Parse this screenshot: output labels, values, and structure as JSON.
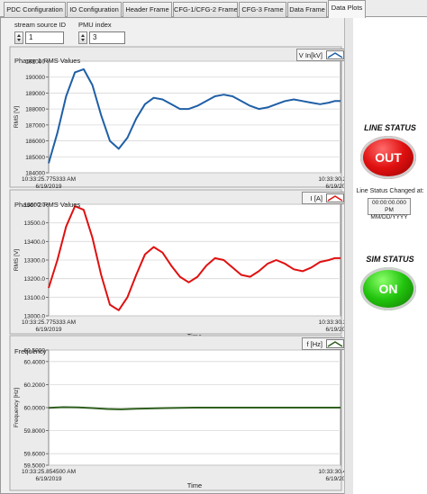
{
  "tabs": [
    {
      "label": "PDC Configuration"
    },
    {
      "label": "IO Configuration"
    },
    {
      "label": "Header Frame"
    },
    {
      "label": "CFG-1/CFG-2 Frame"
    },
    {
      "label": "CFG-3 Frame"
    },
    {
      "label": "Data Frame"
    },
    {
      "label": "Data Plots"
    }
  ],
  "controls": {
    "stream_source": {
      "label": "stream source ID",
      "value": "1"
    },
    "pmu_index": {
      "label": "PMU index",
      "value": "3"
    }
  },
  "charts": [
    {
      "title": "Phasor 1 RMS Values",
      "legend": "V In[kV]",
      "color": "#1f5fa6",
      "ylabel": "RMS [V]",
      "xlabel": "Time",
      "x_start": [
        "10:33:25.775333 AM",
        "6/19/2019"
      ],
      "x_end": [
        "10:33:30.23366",
        "6/19/2019"
      ],
      "yticks": [
        "191000",
        "190000",
        "189000",
        "188000",
        "187000",
        "186000",
        "185000",
        "184000"
      ]
    },
    {
      "title": "Phasor 2 RMS Values",
      "legend": "I [A]",
      "color": "#e01010",
      "ylabel": "RMS [V]",
      "xlabel": "Time",
      "x_start": [
        "10:33:25.775333 AM",
        "6/19/2019"
      ],
      "x_end": [
        "10:33:30.32116",
        "6/19/2019"
      ],
      "yticks": [
        "13600.0",
        "13500.0",
        "13400.0",
        "13300.0",
        "13200.0",
        "13100.0",
        "13000.0"
      ]
    },
    {
      "title": "Frequency",
      "legend": "f [Hz]",
      "color": "#2f5f1e",
      "ylabel": "Frequency [Hz]",
      "xlabel": "Time",
      "x_start": [
        "10:33:25.854500 AM",
        "6/19/2019"
      ],
      "x_end": [
        "10:33:30.40033",
        "6/19/2019"
      ],
      "yticks": [
        "60.5000",
        "60.4000",
        "60.2000",
        "60.0000",
        "59.8000",
        "59.6000",
        "59.5000"
      ]
    }
  ],
  "chart_data": [
    {
      "type": "line",
      "title": "Phasor 1 RMS Values",
      "xlabel": "Time",
      "ylabel": "RMS [V]",
      "ylim": [
        184000,
        191000
      ],
      "series": [
        {
          "name": "V In[kV]",
          "values": [
            184600,
            186500,
            188800,
            190300,
            190500,
            189500,
            187600,
            186000,
            185500,
            186200,
            187400,
            188300,
            188700,
            188600,
            188300,
            188000,
            188000,
            188200,
            188500,
            188800,
            188900,
            188800,
            188500,
            188200,
            188000,
            188100,
            188300,
            188500,
            188600,
            188500,
            188400,
            188300,
            188400,
            188500,
            188500
          ]
        }
      ],
      "x": [
        0,
        0.03,
        0.06,
        0.09,
        0.12,
        0.15,
        0.18,
        0.21,
        0.24,
        0.27,
        0.3,
        0.33,
        0.36,
        0.39,
        0.42,
        0.45,
        0.48,
        0.51,
        0.54,
        0.57,
        0.6,
        0.63,
        0.66,
        0.69,
        0.72,
        0.75,
        0.78,
        0.81,
        0.84,
        0.87,
        0.9,
        0.93,
        0.96,
        0.98,
        1.0
      ]
    },
    {
      "type": "line",
      "title": "Phasor 2 RMS Values",
      "xlabel": "Time",
      "ylabel": "RMS [V]",
      "ylim": [
        13000,
        13600
      ],
      "series": [
        {
          "name": "I [A]",
          "values": [
            13150,
            13300,
            13480,
            13590,
            13570,
            13420,
            13220,
            13060,
            13030,
            13100,
            13220,
            13330,
            13370,
            13340,
            13270,
            13210,
            13180,
            13210,
            13270,
            13310,
            13300,
            13260,
            13220,
            13210,
            13240,
            13280,
            13300,
            13280,
            13250,
            13240,
            13260,
            13290,
            13300,
            13310,
            13310
          ]
        }
      ],
      "x": [
        0,
        0.03,
        0.06,
        0.09,
        0.12,
        0.15,
        0.18,
        0.21,
        0.24,
        0.27,
        0.3,
        0.33,
        0.36,
        0.39,
        0.42,
        0.45,
        0.48,
        0.51,
        0.54,
        0.57,
        0.6,
        0.63,
        0.66,
        0.69,
        0.72,
        0.75,
        0.78,
        0.81,
        0.84,
        0.87,
        0.9,
        0.93,
        0.96,
        0.98,
        1.0
      ]
    },
    {
      "type": "line",
      "title": "Frequency",
      "xlabel": "Time",
      "ylabel": "Frequency [Hz]",
      "ylim": [
        59.5,
        60.5
      ],
      "series": [
        {
          "name": "f [Hz]",
          "values": [
            59.998,
            60.004,
            60.002,
            59.996,
            59.988,
            59.985,
            59.99,
            59.996,
            60.0,
            60.0,
            60.0,
            60.0,
            60.0,
            60.0
          ]
        }
      ],
      "x": [
        0,
        0.05,
        0.1,
        0.15,
        0.2,
        0.25,
        0.3,
        0.4,
        0.5,
        0.6,
        0.7,
        0.8,
        0.9,
        1.0
      ]
    }
  ],
  "status": {
    "line_status": {
      "title": "LINE STATUS",
      "value": "OUT",
      "color": "#e01010"
    },
    "changed_label": "Line Status Changed at:",
    "changed_time": "00:00:00.000 PM",
    "changed_date": "MM/DD/YYYY",
    "sim_status": {
      "title": "SIM STATUS",
      "value": "ON",
      "color": "#22c40e"
    }
  }
}
